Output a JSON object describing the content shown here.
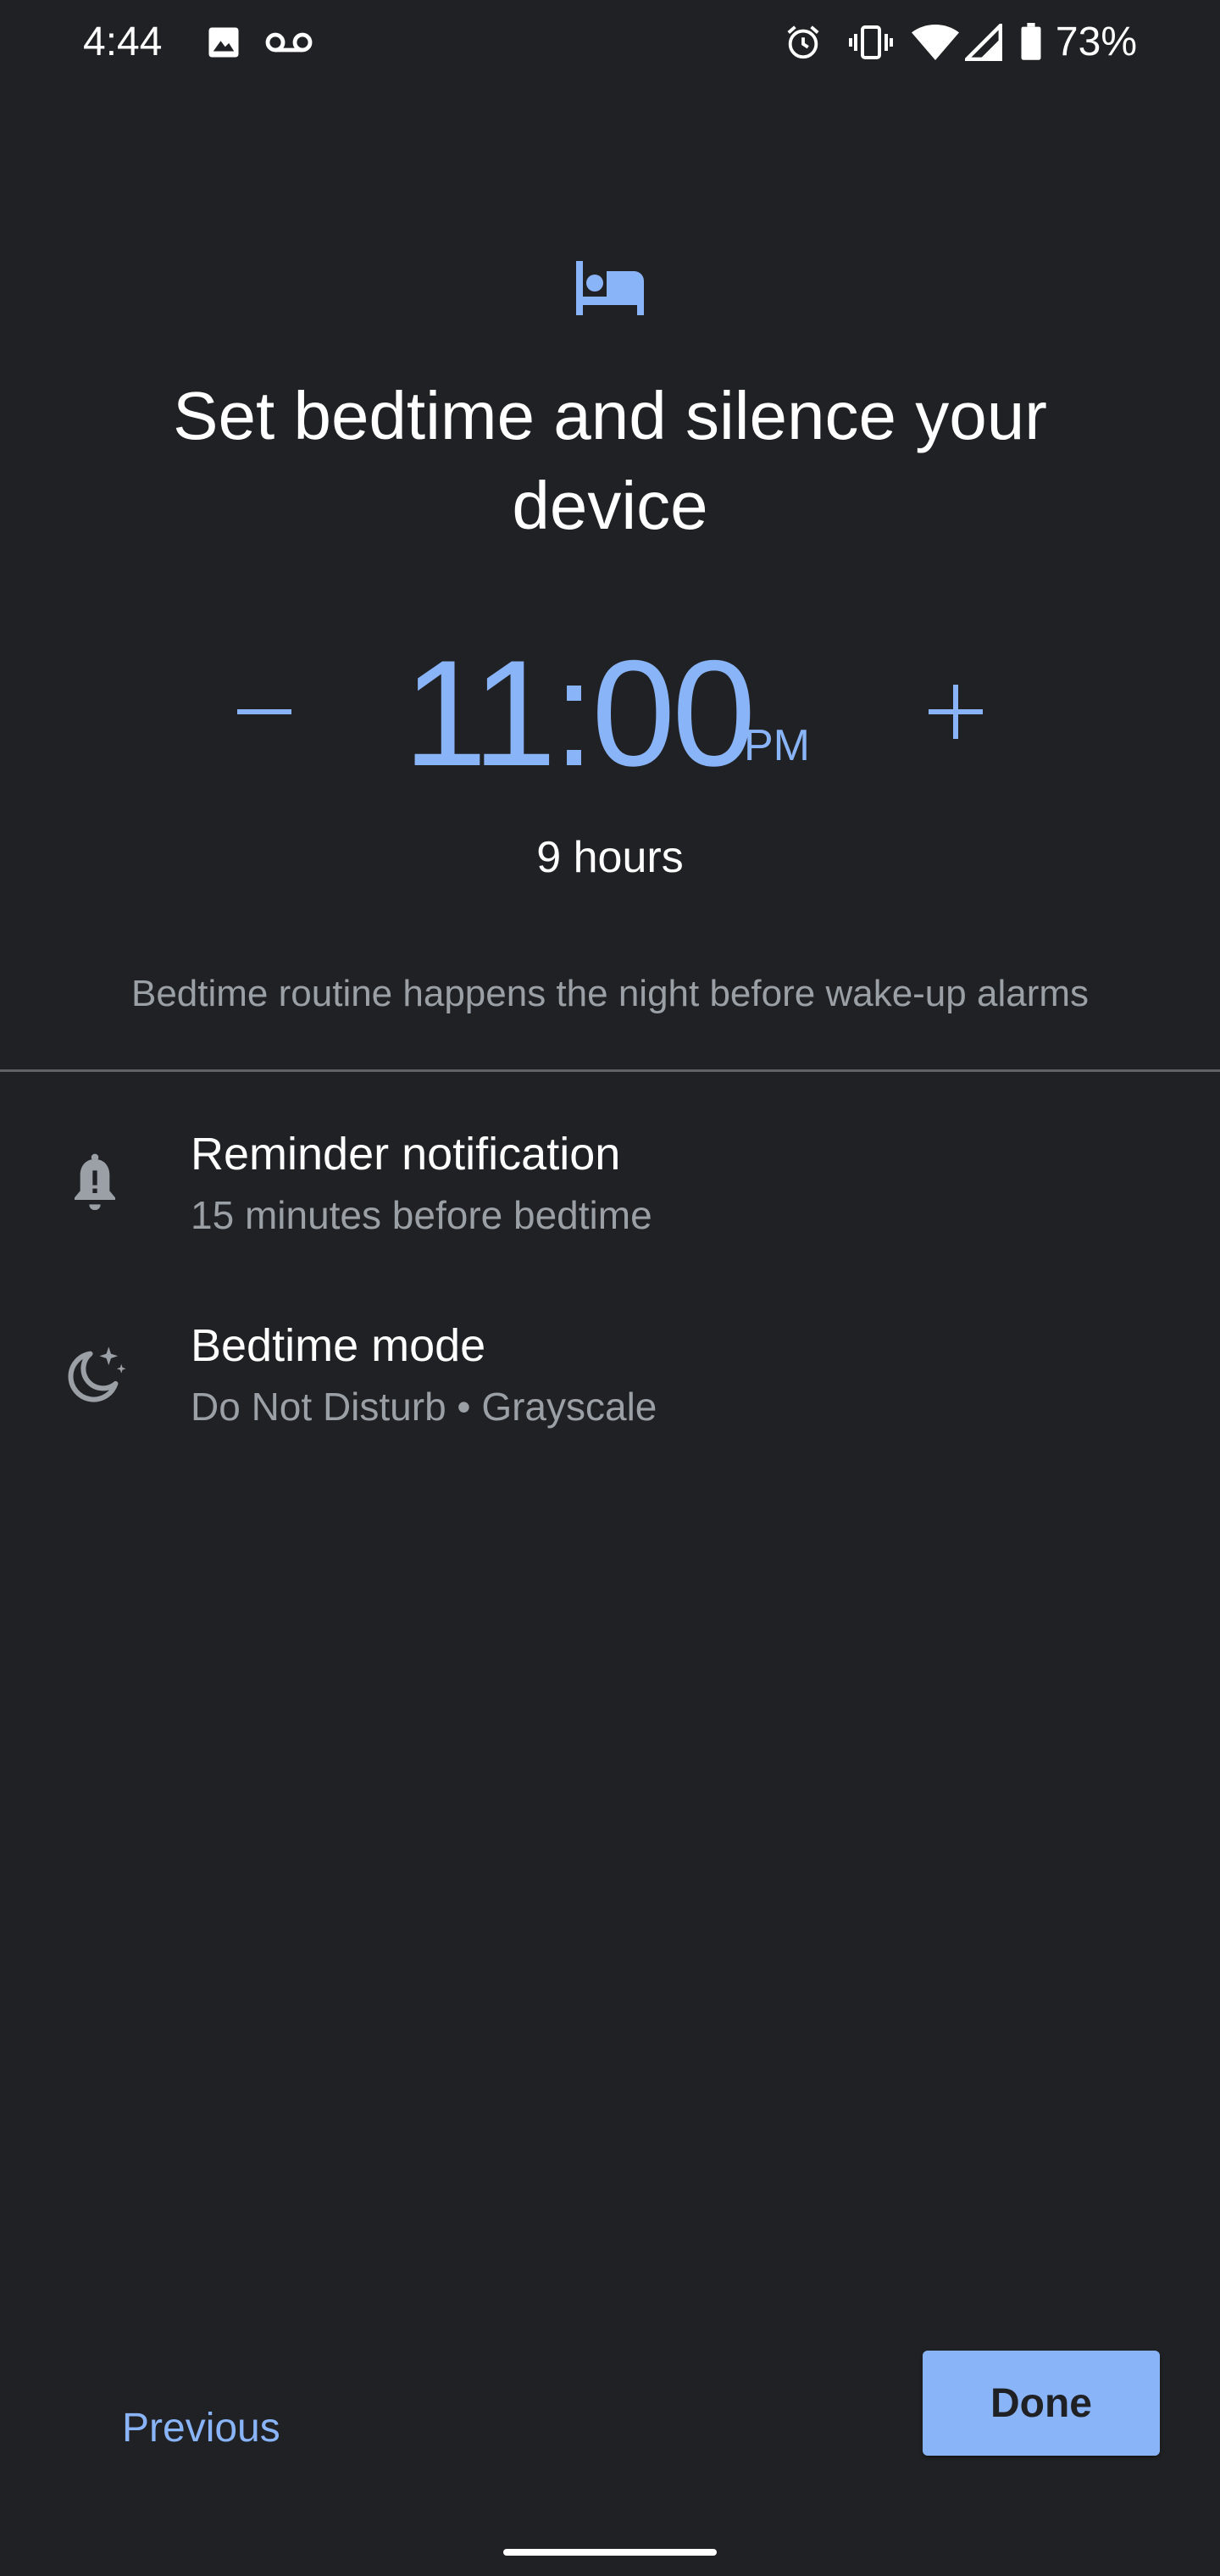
{
  "status_bar": {
    "time": "4:44",
    "battery": "73%",
    "icons": [
      "image-icon",
      "voicemail-icon",
      "alarm-icon",
      "vibrate-icon",
      "wifi-icon",
      "signal-icon",
      "battery-icon"
    ]
  },
  "header": {
    "icon": "bed-icon",
    "title": "Set bedtime and silence your device"
  },
  "time_picker": {
    "decrement_symbol": "−",
    "increment_symbol": "+",
    "time": "11:00",
    "ampm": "PM",
    "duration": "9 hours"
  },
  "note": "Bedtime routine happens the night before wake-up alarms",
  "settings": [
    {
      "icon": "bell-alert-icon",
      "title": "Reminder notification",
      "subtitle": "15 minutes before bedtime"
    },
    {
      "icon": "moon-stars-icon",
      "title": "Bedtime mode",
      "subtitle": "Do Not Disturb • Grayscale"
    }
  ],
  "footer": {
    "previous_label": "Previous",
    "done_label": "Done"
  },
  "colors": {
    "background": "#202124",
    "accent": "#8ab4f8",
    "text_primary": "#ffffff",
    "text_secondary": "#9aa0a6",
    "divider": "#5f6368"
  }
}
